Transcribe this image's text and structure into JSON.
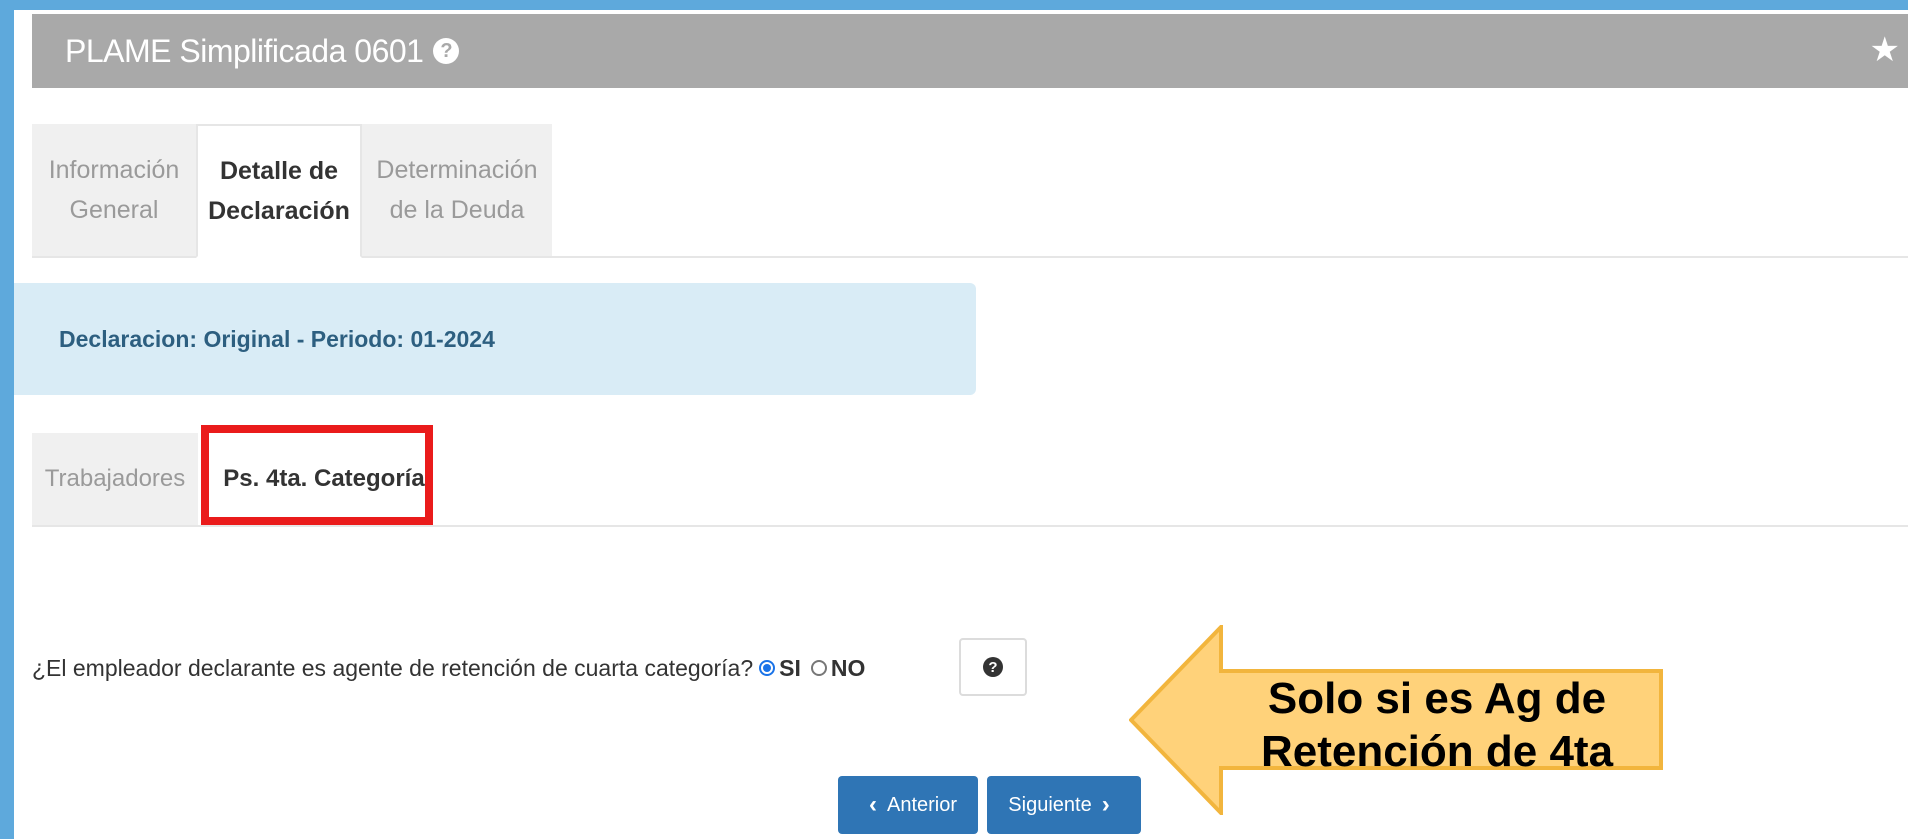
{
  "header": {
    "title": "PLAME Simplificada 0601",
    "help_icon": "?",
    "favorite_icon": "★"
  },
  "main_tabs": [
    {
      "line1": "Información",
      "line2": "General",
      "active": false
    },
    {
      "line1": "Detalle de",
      "line2": "Declaración",
      "active": true
    },
    {
      "line1": "Determinación",
      "line2": "de la Deuda",
      "active": false
    }
  ],
  "info_box": {
    "text": "Declaracion: Original - Periodo: 01-2024"
  },
  "sub_tabs": [
    {
      "label": "Trabajadores",
      "active": false
    },
    {
      "label": "Ps. 4ta. Categoría",
      "active": true
    }
  ],
  "question": {
    "text": "¿El empleador declarante es agente de retención de cuarta categoría?",
    "option_yes": "SI",
    "option_no": "NO",
    "selected": "SI",
    "help_icon": "?"
  },
  "callout": {
    "line1": "Solo si es Ag de",
    "line2": "Retención de 4ta",
    "fill_color": "#ffd27a",
    "stroke_color": "#f2b53d"
  },
  "nav": {
    "prev_label": "Anterior",
    "next_label": "Siguiente",
    "prev_icon": "‹",
    "next_icon": "›"
  },
  "colors": {
    "header_bg": "#a9a9a9",
    "info_bg": "#d9ecf6",
    "button_bg": "#2f75b5",
    "highlight": "#ea1b1b"
  }
}
